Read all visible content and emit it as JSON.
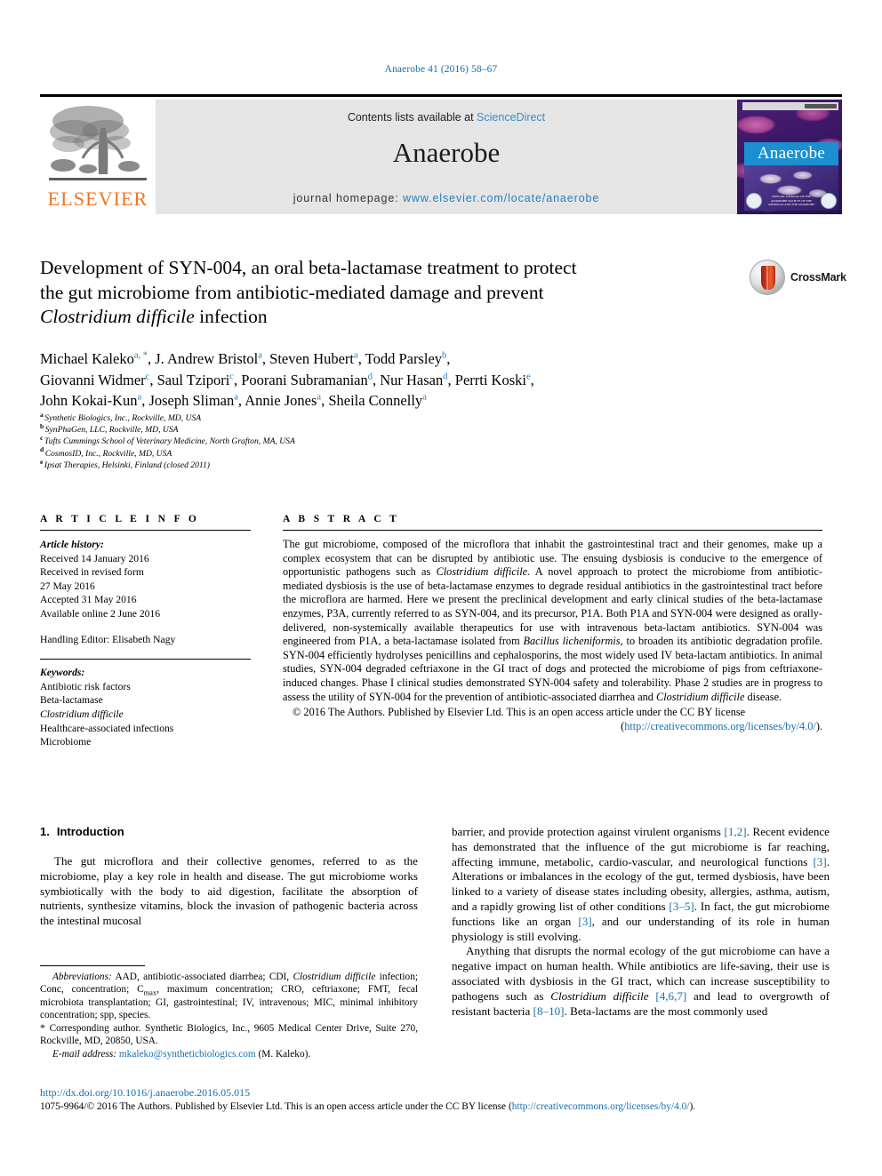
{
  "running_head": "Anaerobe 41 (2016) 58–67",
  "masthead": {
    "publisher_logo_label": "ELSEVIER",
    "contents_prefix": "Contents lists available at ",
    "contents_link": "ScienceDirect",
    "journal_title": "Anaerobe",
    "homepage_prefix": "journal homepage: ",
    "homepage_url": "www.elsevier.com/locate/anaerobe",
    "cover_title": "Anaerobe",
    "cover_caption": "OFFICIAL JOURNAL OF THE ANAEROBE SOCIETY OF THE AMERICAS AND THE ANAEROBE SOCIETY"
  },
  "crossmark": {
    "label": "CrossMark"
  },
  "title": {
    "line1": "Development of SYN-004, an oral beta-lactamase treatment to protect",
    "line2": "the gut microbiome from antibiotic-mediated damage and prevent",
    "line3_italic": "Clostridium difficile",
    "line3_rest": " infection"
  },
  "authors": [
    {
      "name": "Michael Kaleko",
      "sup": "a, *",
      "sep": ", "
    },
    {
      "name": "J. Andrew Bristol",
      "sup": "a",
      "sep": ", "
    },
    {
      "name": "Steven Hubert",
      "sup": "a",
      "sep": ", "
    },
    {
      "name": "Todd Parsley",
      "sup": "b",
      "sep": ", "
    },
    {
      "name": "Giovanni Widmer",
      "sup": "c",
      "sep": ", "
    },
    {
      "name": "Saul Tzipori",
      "sup": "c",
      "sep": ", "
    },
    {
      "name": "Poorani Subramanian",
      "sup": "d",
      "sep": ", "
    },
    {
      "name": "Nur Hasan",
      "sup": "d",
      "sep": ", "
    },
    {
      "name": "Perrti Koski",
      "sup": "e",
      "sep": ", "
    },
    {
      "name": "John Kokai-Kun",
      "sup": "a",
      "sep": ", "
    },
    {
      "name": "Joseph Sliman",
      "sup": "a",
      "sep": ", "
    },
    {
      "name": "Annie Jones",
      "sup": "a",
      "sep": ", "
    },
    {
      "name": "Sheila Connelly",
      "sup": "a",
      "sep": ""
    }
  ],
  "affiliations": [
    {
      "marker": "a",
      "text": "Synthetic Biologics, Inc., Rockville, MD, USA"
    },
    {
      "marker": "b",
      "text": "SynPhaGen, LLC, Rockville, MD, USA"
    },
    {
      "marker": "c",
      "text": "Tufts Cummings School of Veterinary Medicine, North Grafton, MA, USA"
    },
    {
      "marker": "d",
      "text": "CosmosID, Inc., Rockville, MD, USA"
    },
    {
      "marker": "e",
      "text": "Ipsat Therapies, Helsinki, Finland (closed 2011)"
    }
  ],
  "article_info": {
    "heading": "A R T I C L E  I N F O",
    "history_label": "Article history:",
    "history": [
      "Received 14 January 2016",
      "Received in revised form",
      "27 May 2016",
      "Accepted 31 May 2016",
      "Available online 2 June 2016"
    ],
    "handling_editor": "Handling Editor: Elisabeth Nagy",
    "keywords_label": "Keywords:",
    "keywords": [
      {
        "text": "Antibiotic risk factors",
        "italic": false
      },
      {
        "text": "Beta-lactamase",
        "italic": false
      },
      {
        "text": "Clostridium difficile",
        "italic": true
      },
      {
        "text": "Healthcare-associated infections",
        "italic": false
      },
      {
        "text": "Microbiome",
        "italic": false
      }
    ]
  },
  "abstract": {
    "heading": "A B S T R A C T",
    "part1": "The gut microbiome, composed of the microflora that inhabit the gastrointestinal tract and their genomes, make up a complex ecosystem that can be disrupted by antibiotic use. The ensuing dysbiosis is conducive to the emergence of opportunistic pathogens such as ",
    "italic1": "Clostridium difficile",
    "part2": ". A novel approach to protect the microbiome from antibiotic-mediated dysbiosis is the use of beta-lactamase enzymes to degrade residual antibiotics in the gastrointestinal tract before the microflora are harmed. Here we present the preclinical development and early clinical studies of the beta-lactamase enzymes, P3A, currently referred to as SYN-004, and its precursor, P1A. Both P1A and SYN-004 were designed as orally-delivered, non-systemically available therapeutics for use with intravenous beta-lactam antibiotics. SYN-004 was engineered from P1A, a beta-lactamase isolated from ",
    "italic2": "Bacillus licheniformis",
    "part3": ", to broaden its antibiotic degradation profile. SYN-004 efficiently hydrolyses penicillins and cephalosporins, the most widely used IV beta-lactam antibiotics. In animal studies, SYN-004 degraded ceftriaxone in the GI tract of dogs and protected the microbiome of pigs from ceftriaxone-induced changes. Phase I clinical studies demonstrated SYN-004 safety and tolerability. Phase 2 studies are in progress to assess the utility of SYN-004 for the prevention of antibiotic-associated diarrhea and ",
    "italic3": "Clostridium difficile",
    "part4": " disease.",
    "copyright": "© 2016 The Authors. Published by Elsevier Ltd. This is an open access article under the CC BY license",
    "license_open": "(",
    "license_url": "http://creativecommons.org/licenses/by/4.0/",
    "license_close": ")."
  },
  "section": {
    "number": "1.",
    "title": "Introduction"
  },
  "body": {
    "left_p1": "The gut microflora and their collective genomes, referred to as the microbiome, play a key role in health and disease. The gut microbiome works symbiotically with the body to aid digestion, facilitate the absorption of nutrients, synthesize vitamins, block the invasion of pathogenic bacteria across the intestinal mucosal",
    "right_p1_a": "barrier, and provide protection against virulent organisms ",
    "right_p1_ref1": "[1,2]",
    "right_p1_b": ". Recent evidence has demonstrated that the influence of the gut microbiome is far reaching, affecting immune, metabolic, cardio-vascular, and neurological functions ",
    "right_p1_ref2": "[3]",
    "right_p1_c": ". Alterations or imbalances in the ecology of the gut, termed dysbiosis, have been linked to a variety of disease states including obesity, allergies, asthma, autism, and a rapidly growing list of other conditions ",
    "right_p1_ref3": "[3–5]",
    "right_p1_d": ". In fact, the gut microbiome functions like an organ ",
    "right_p1_ref4": "[3]",
    "right_p1_e": ", and our understanding of its role in human physiology is still evolving.",
    "right_p2_a": "Anything that disrupts the normal ecology of the gut microbiome can have a negative impact on human health. While antibiotics are life-saving, their use is associated with dysbiosis in the GI tract, which can increase susceptibility to pathogens such as ",
    "right_p2_ital": "Clostridium difficile",
    "right_p2_b": " ",
    "right_p2_ref1": "[4,6,7]",
    "right_p2_c": " and lead to overgrowth of resistant bacteria ",
    "right_p2_ref2": "[8–10]",
    "right_p2_d": ". Beta-lactams are the most commonly used"
  },
  "footnotes": {
    "abbrev_label": "Abbreviations:",
    "abbrev_a": " AAD, antibiotic-associated diarrhea; CDI, ",
    "abbrev_ital": "Clostridium difficile",
    "abbrev_b": " infection; Conc, concentration; C",
    "abbrev_sub": "max",
    "abbrev_c": ", maximum concentration; CRO, ceftriaxone; FMT, fecal microbiota transplantation; GI, gastrointestinal; IV, intravenous; MIC, minimal inhibitory concentration; spp, species.",
    "corresponding_star": "*",
    "corresponding": " Corresponding author. Synthetic Biologics, Inc., 9605 Medical Center Drive, Suite 270, Rockville, MD, 20850, USA.",
    "email_label": "E-mail address:",
    "email": "mkaleko@syntheticbiologics.com",
    "email_suffix": " (M. Kaleko)."
  },
  "footer": {
    "doi": "http://dx.doi.org/10.1016/j.anaerobe.2016.05.015",
    "issn_a": "1075-9964/© 2016 The Authors. Published by Elsevier Ltd. This is an open access article under the CC BY license (",
    "issn_url": "http://creativecommons.org/licenses/by/4.0/",
    "issn_b": ")."
  },
  "colors": {
    "link_blue": "#1a6ea8",
    "elsevier_orange": "#ec7623",
    "band_gray": "#e5e5e5"
  }
}
